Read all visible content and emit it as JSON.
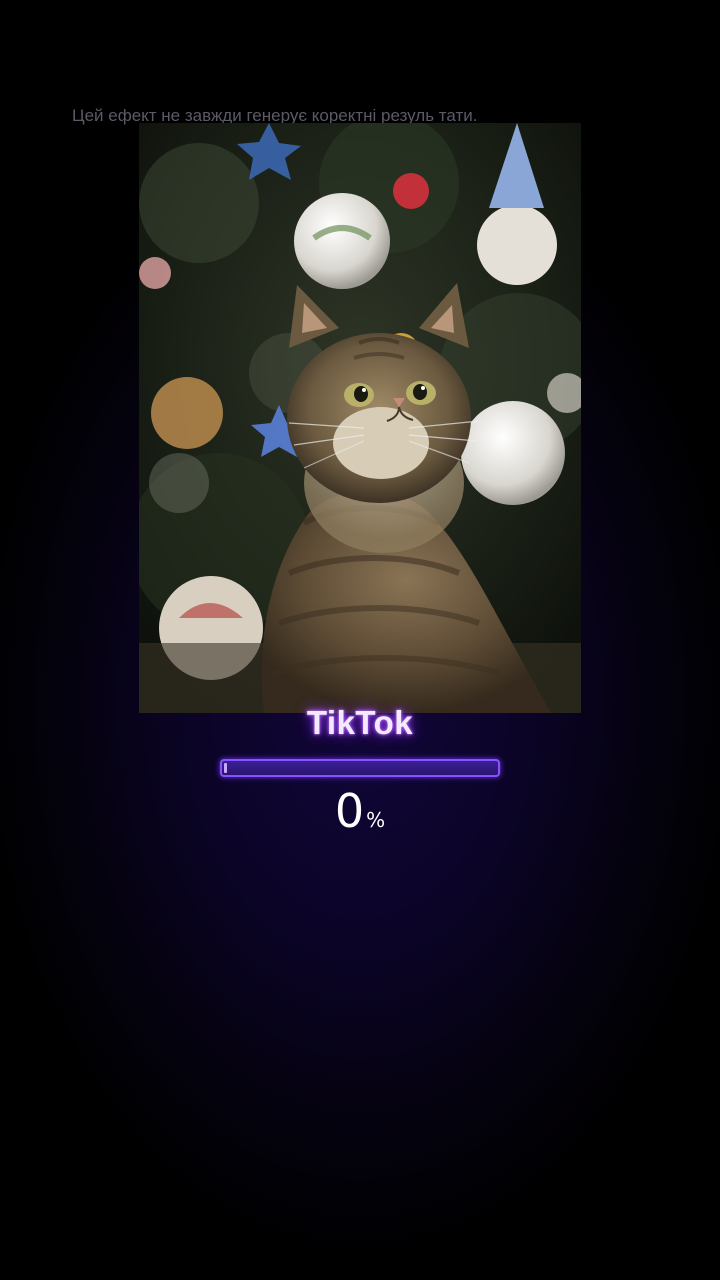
{
  "overlay": {
    "disclaimer": "Цей ефект не завжди генерує коректні резуль тати."
  },
  "photo": {
    "subject_icon": "cat-photo"
  },
  "brand": {
    "name": "TikTok"
  },
  "progress": {
    "value": 0,
    "percent_text": "0",
    "percent_sign": "%"
  },
  "colors": {
    "background": "#0b0426",
    "accent": "#8a52ff",
    "glow": "#b05cff",
    "disclaimer_text": "#5c5a66"
  }
}
